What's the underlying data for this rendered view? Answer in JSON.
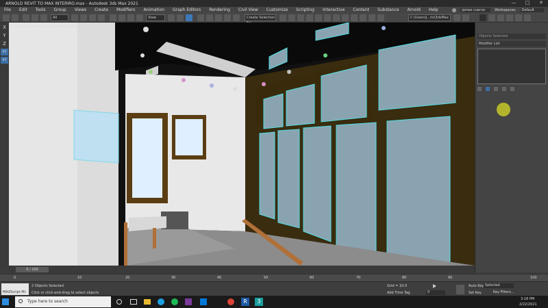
{
  "app": {
    "title": "ARNOLD REVIT TO MAX INTERIRO.max - Autodesk 3ds Max 2021",
    "window_controls": [
      "—",
      "□",
      "✕"
    ]
  },
  "menu": {
    "items": [
      "File",
      "Edit",
      "Tools",
      "Group",
      "Views",
      "Create",
      "Modifiers",
      "Animation",
      "Graph Editors",
      "Rendering",
      "Civil View",
      "Customize",
      "Scripting",
      "Interactive",
      "Content",
      "Substance",
      "Arnold",
      "Help"
    ],
    "user": "james cuervo",
    "workspace_label": "Workspaces:",
    "workspace_value": "Default"
  },
  "toolbar": {
    "filter": "All",
    "view": "View",
    "selection_set": "Create Selection Se",
    "path": "C:\\Users\\J...ris\\3dsMax"
  },
  "axes": [
    "X",
    "Y",
    "Z",
    "XY",
    "XY"
  ],
  "viewport": {
    "label": "[+] [PhysCamera001] [Standard] [Default Shading]"
  },
  "command_panel": {
    "search_placeholder": "Objects Selected",
    "modifier_list": "Modifier List"
  },
  "timeline": {
    "frame": "0 / 100",
    "ticks": [
      "0",
      "5",
      "10",
      "15",
      "20",
      "25",
      "30",
      "35",
      "40",
      "45",
      "50",
      "55",
      "60",
      "65",
      "70",
      "75",
      "80",
      "85",
      "90",
      "95",
      "100"
    ]
  },
  "status": {
    "selected": "2 Objects Selected",
    "hint": "Click or click-and-drag to select objects",
    "maxscript": "MAXScript Mi:",
    "grid": "Grid = 10.0",
    "add_time_tag": "Add Time Tag",
    "auto_key": "Auto Key",
    "set_key": "Set Key",
    "selected_dd": "Selected",
    "key_filters": "Key Filters...",
    "frame_value": "0"
  },
  "taskbar": {
    "search_placeholder": "Type here to search",
    "time": "3:18 PM",
    "date": "2/22/2021"
  }
}
